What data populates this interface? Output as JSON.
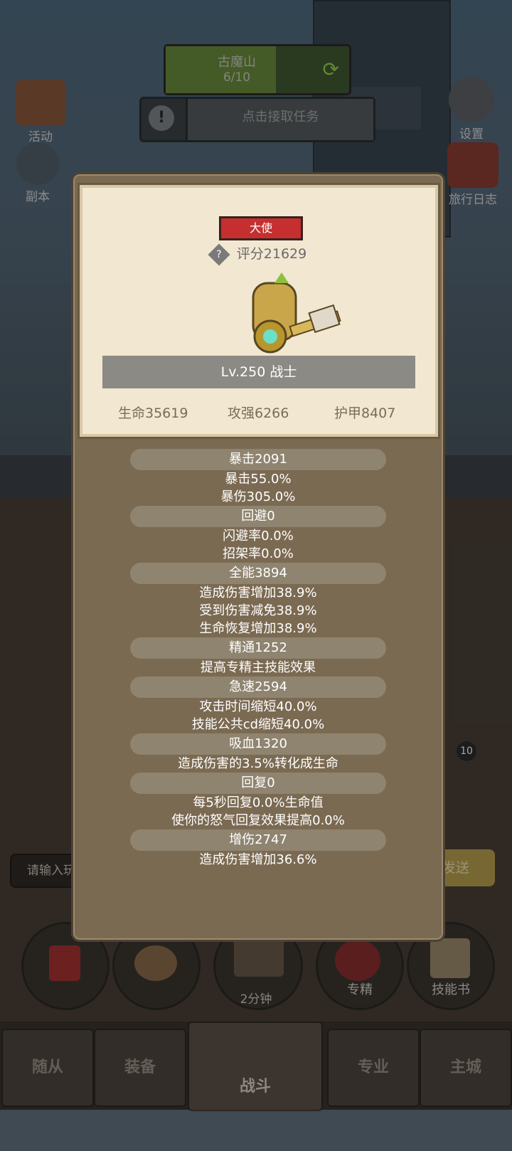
{
  "level": {
    "name": "古魔山",
    "progress": "6/10",
    "progress_fraction": 0.6
  },
  "task": {
    "label": "点击接取任务"
  },
  "left_buttons": {
    "activity": "活动",
    "dungeon": "副本"
  },
  "right_buttons": {
    "settings": "设置",
    "travel_log": "旅行日志"
  },
  "chat": {
    "input_placeholder": "请输入玩",
    "send": "发送"
  },
  "item_badge": "10",
  "bottom_actions": {
    "gift_timer": "2分钟",
    "specialization": "专精",
    "skill_book": "技能书"
  },
  "nav": {
    "followers": "随从",
    "equipment": "装备",
    "battle": "战斗",
    "profession": "专业",
    "main_city": "主城"
  },
  "hero": {
    "rank": "大使",
    "score": "评分21629",
    "level_class": "Lv.250 战士",
    "hp": "生命35619",
    "attack": "攻强6266",
    "armor": "护甲8407"
  },
  "attributes": [
    {
      "head": "暴击2091",
      "lines": [
        "暴击55.0%",
        "暴伤305.0%"
      ]
    },
    {
      "head": "回避0",
      "lines": [
        "闪避率0.0%",
        "招架率0.0%"
      ]
    },
    {
      "head": "全能3894",
      "lines": [
        "造成伤害增加38.9%",
        "受到伤害减免38.9%",
        "生命恢复增加38.9%"
      ]
    },
    {
      "head": "精通1252",
      "lines": [
        "提高专精主技能效果"
      ]
    },
    {
      "head": "急速2594",
      "lines": [
        "攻击时间缩短40.0%",
        "技能公共cd缩短40.0%"
      ]
    },
    {
      "head": "吸血1320",
      "lines": [
        "造成伤害的3.5%转化成生命"
      ]
    },
    {
      "head": "回复0",
      "lines": [
        "每5秒回复0.0%生命值",
        "使你的怒气回复效果提高0.0%"
      ]
    },
    {
      "head": "增伤2747",
      "lines": [
        "造成伤害增加36.6%"
      ]
    }
  ],
  "colors": {
    "rank_red": "#c62f2f",
    "modal_bg": "#7b6a52",
    "card_bg": "#f2e8d2"
  }
}
